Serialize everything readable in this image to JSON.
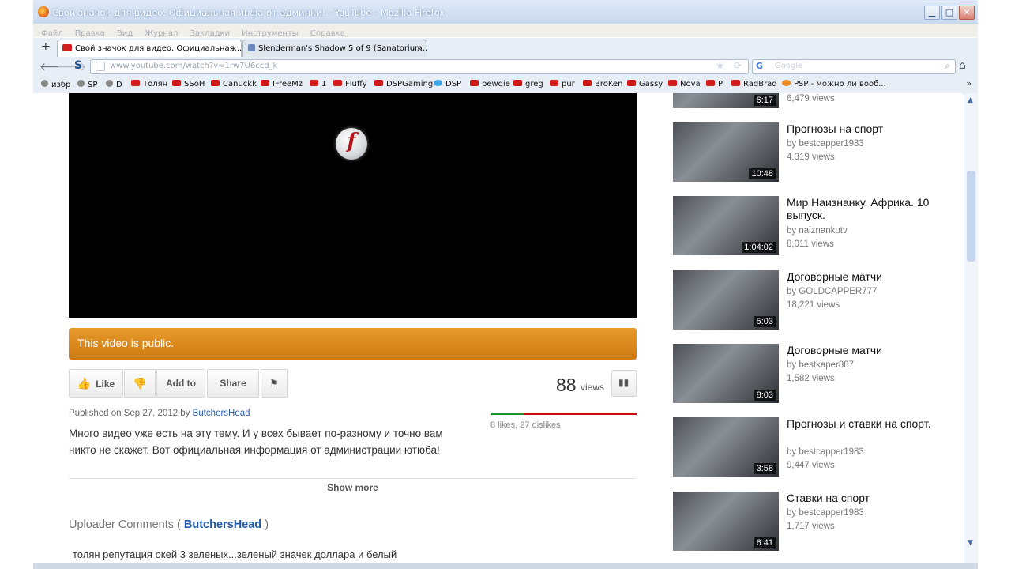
{
  "window": {
    "title": "Свой значок для видео. Официальная инфа от админки! - YouTube - Mozilla Firefox",
    "min_label": "▁",
    "max_label": "□",
    "close_label": "✕"
  },
  "menu": [
    "Файл",
    "Правка",
    "Вид",
    "Журнал",
    "Закладки",
    "Инструменты",
    "Справка"
  ],
  "tabs": [
    {
      "label": "Свой значок для видео. Официальная..."
    },
    {
      "label": "Slenderman's Shadow 5 of 9 (Sanatorium..."
    }
  ],
  "tab_close": "×",
  "new_tab": "+",
  "nav": {
    "back": "🡐",
    "forward": "🡒",
    "s_icon": "S",
    "url": "www.youtube.com/watch?v=1rw7U6ccd_k",
    "search_placeholder": "Google",
    "home": "⌂"
  },
  "bookmarks": [
    {
      "label": "избр",
      "icon": "gear-icon"
    },
    {
      "label": "SP",
      "icon": "gear-icon"
    },
    {
      "label": "D",
      "icon": "gear-icon"
    },
    {
      "label": "Толян",
      "icon": "youtube-icon"
    },
    {
      "label": "SSoH",
      "icon": "youtube-icon"
    },
    {
      "label": "Canuckk",
      "icon": "youtube-icon"
    },
    {
      "label": "IFreeMz",
      "icon": "youtube-icon"
    },
    {
      "label": "1",
      "icon": "youtube-icon"
    },
    {
      "label": "Fluffy",
      "icon": "youtube-icon"
    },
    {
      "label": "DSPGaming",
      "icon": "youtube-icon"
    },
    {
      "label": "DSP",
      "icon": "twitter-icon"
    },
    {
      "label": "pewdie",
      "icon": "youtube-icon"
    },
    {
      "label": "greg",
      "icon": "youtube-icon"
    },
    {
      "label": "pur",
      "icon": "youtube-icon"
    },
    {
      "label": "BroKen",
      "icon": "youtube-icon"
    },
    {
      "label": "Gassy",
      "icon": "youtube-icon"
    },
    {
      "label": "Nova",
      "icon": "youtube-icon"
    },
    {
      "label": "P",
      "icon": "youtube-icon"
    },
    {
      "label": "RadBrad",
      "icon": "youtube-icon"
    },
    {
      "label": "PSP - можно ли вооб...",
      "icon": "orange-globe-icon"
    }
  ],
  "bookmarks_more": "»",
  "video": {
    "public_notice": "This video is public.",
    "like_label": "Like",
    "add_to_label": "Add to",
    "share_label": "Share",
    "views_count": "88",
    "views_word": "views",
    "likes_dislikes": "8 likes, 27 dislikes",
    "likes": 8,
    "dislikes": 27,
    "published_prefix": "Published on Sep 27, 2012 by",
    "uploader": "ButchersHead",
    "description": "Много видео уже есть на эту тему. И у всех бывает по-разному и точно вам никто не скажет. Вот официальная информация от администрации ютюба!",
    "show_more": "Show more",
    "uploader_comments_label": "Uploader Comments (",
    "uploader_comments_name": "ButchersHead",
    "uploader_comments_close": ")",
    "comment_text": "толян репутация окей 3 зеленых...зеленый значек доллара и белый"
  },
  "sidebar": [
    {
      "title": "",
      "by": "",
      "views": "6,479 views",
      "duration": "6:17"
    },
    {
      "title": "Прогнозы на спорт",
      "by": "by bestcapper1983",
      "views": "4,319 views",
      "duration": "10:48"
    },
    {
      "title": "Мир Наизнанку. Африка. 10 выпуск.",
      "by": "by naiznankutv",
      "views": "8,011 views",
      "duration": "1:04:02"
    },
    {
      "title": "Договорные матчи",
      "by": "by GOLDCAPPER777",
      "views": "18,221 views",
      "duration": "5:03"
    },
    {
      "title": "Договорные матчи",
      "by": "by bestkaper887",
      "views": "1,582 views",
      "duration": "8:03"
    },
    {
      "title": "Прогнозы и ставки на спорт.",
      "by": "by bestcapper1983",
      "views": "9,447 views",
      "duration": "3:58"
    },
    {
      "title": "Ставки на спорт",
      "by": "by bestcapper1983",
      "views": "1,717 views",
      "duration": "6:41"
    }
  ],
  "colors": {
    "public_bar": "#d9850f",
    "like_green": "#1f9126",
    "dislike_red": "#cc0d0d",
    "link_blue": "#2a5db0"
  }
}
